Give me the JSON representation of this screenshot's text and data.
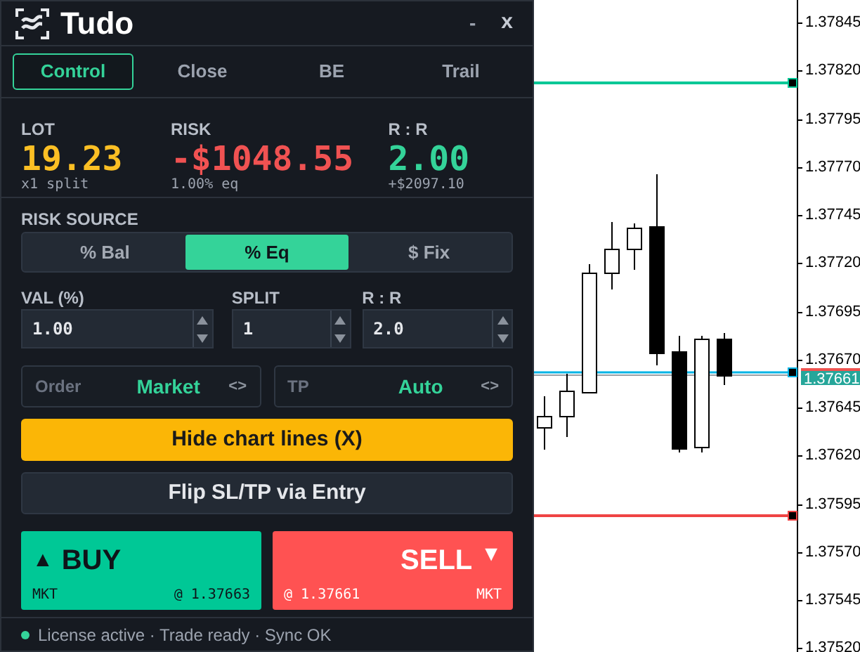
{
  "window": {
    "title": "Tudo",
    "minimize": "-",
    "close": "x"
  },
  "tabs": [
    {
      "label": "Control",
      "selected": true
    },
    {
      "label": "Close",
      "selected": false
    },
    {
      "label": "BE",
      "selected": false
    },
    {
      "label": "Trail",
      "selected": false
    }
  ],
  "stats": [
    {
      "kind": "lot",
      "label": "LOT",
      "value": "19.23",
      "sub": "x1 split"
    },
    {
      "kind": "risk",
      "label": "RISK",
      "value": "-$1048.55",
      "sub": "1.00% eq"
    },
    {
      "kind": "rr",
      "label": "R : R",
      "value": "2.00",
      "sub": "+$2097.10"
    }
  ],
  "risk_source": {
    "label": "RISK SOURCE",
    "options": [
      {
        "label": "% Bal",
        "selected": false
      },
      {
        "label": "% Eq",
        "selected": true
      },
      {
        "label": "$ Fix",
        "selected": false
      }
    ]
  },
  "inputs": [
    {
      "label": "VAL (%)",
      "value": "1.00"
    },
    {
      "label": "SPLIT",
      "value": "1"
    },
    {
      "label": "R : R",
      "value": "2.0"
    }
  ],
  "selectors": [
    {
      "label": "Order",
      "value": "Market",
      "arrows": "<>"
    },
    {
      "label": "TP",
      "value": "Auto",
      "arrows": "<>"
    }
  ],
  "actions": [
    {
      "kind": "warning",
      "label": "Hide chart lines (X)"
    },
    {
      "kind": "plain",
      "label": "Flip SL/TP via Entry"
    }
  ],
  "trade_buttons": [
    {
      "kind": "buy",
      "label": "BUY",
      "arrow": "▲",
      "type": "MKT",
      "price": "@ 1.37663"
    },
    {
      "kind": "sell",
      "label": "SELL",
      "arrow": "▼",
      "type": "MKT",
      "price": "@ 1.37661"
    }
  ],
  "status": {
    "active": true,
    "text": "License active · Trade ready · Sync OK"
  },
  "chart": {
    "price_labels": [
      "1.37845",
      "1.37820",
      "1.37795",
      "1.37770",
      "1.37745",
      "1.37720",
      "1.37695",
      "1.37670",
      "1.37645",
      "1.37620",
      "1.37595",
      "1.37570",
      "1.37545",
      "1.37520"
    ],
    "current_price": "1.37661"
  }
}
